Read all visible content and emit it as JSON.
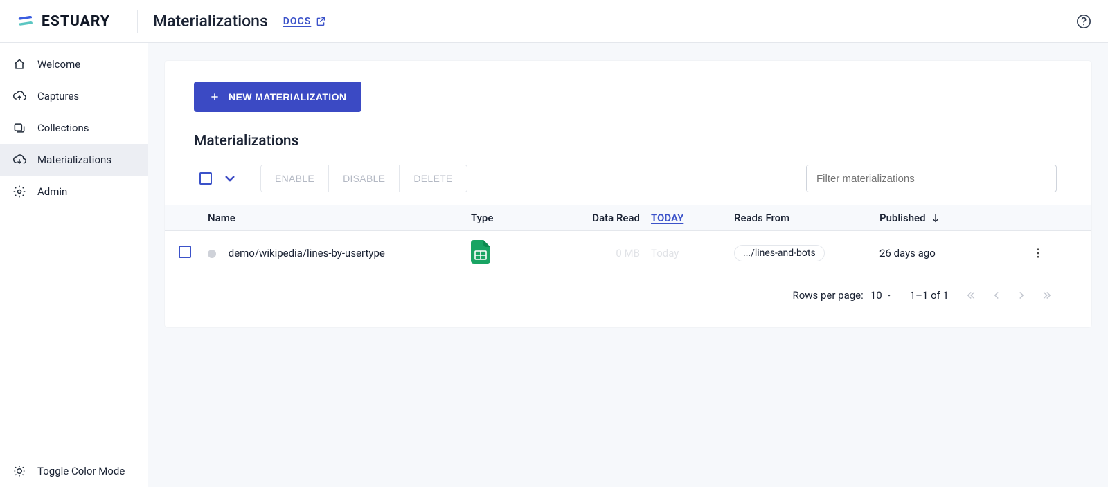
{
  "brand": "ESTUARY",
  "header": {
    "title": "Materializations",
    "docs_label": "DOCS"
  },
  "sidebar": {
    "items": [
      {
        "id": "welcome",
        "label": "Welcome",
        "icon": "home"
      },
      {
        "id": "captures",
        "label": "Captures",
        "icon": "cloud-up"
      },
      {
        "id": "collections",
        "label": "Collections",
        "icon": "layers"
      },
      {
        "id": "materializations",
        "label": "Materializations",
        "icon": "cloud-down"
      },
      {
        "id": "admin",
        "label": "Admin",
        "icon": "gear"
      }
    ],
    "active": "materializations",
    "toggle_label": "Toggle Color Mode"
  },
  "actions": {
    "new_button": "NEW MATERIALIZATION",
    "section_title": "Materializations",
    "enable": "ENABLE",
    "disable": "DISABLE",
    "delete": "DELETE",
    "filter_placeholder": "Filter materializations"
  },
  "table": {
    "columns": {
      "name": "Name",
      "type": "Type",
      "data_read": "Data Read",
      "today": "TODAY",
      "reads_from": "Reads From",
      "published": "Published"
    },
    "rows": [
      {
        "name": "demo/wikipedia/lines-by-usertype",
        "type_icon": "google-sheets",
        "data_read": "0 MB",
        "today": "Today",
        "reads_from": ".../lines-and-bots",
        "published": "26 days ago"
      }
    ]
  },
  "pagination": {
    "rows_per_page_label": "Rows per page:",
    "rows_per_page_value": "10",
    "range": "1–1 of 1"
  }
}
